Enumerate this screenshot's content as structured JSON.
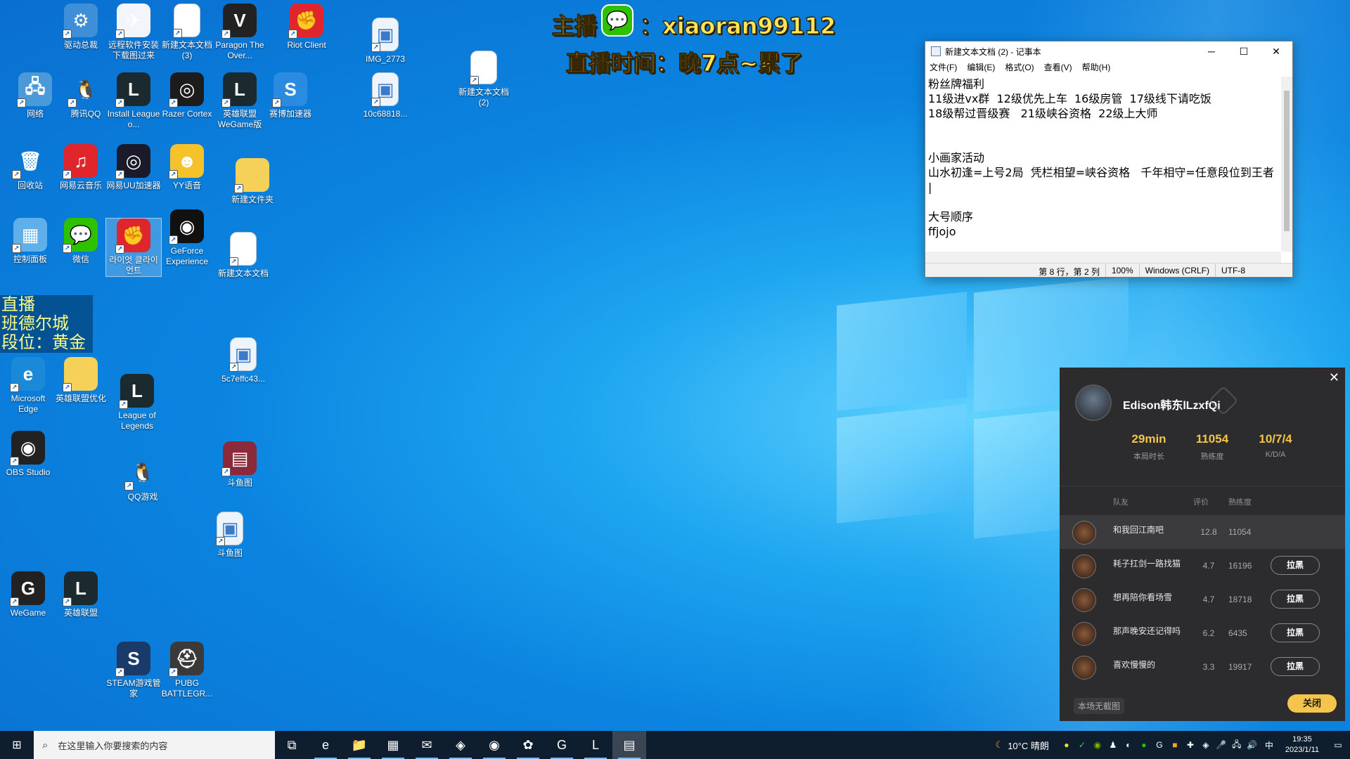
{
  "desktop": {
    "icons": [
      {
        "label": "驱动总裁",
        "glyph": "⚙",
        "bg": "#3f8fd8"
      },
      {
        "label": "远程软件安装下载图过来",
        "glyph": "✈",
        "bg": "#f2f6fa"
      },
      {
        "label": "新建文本文档 (3)",
        "glyph": "",
        "bg": "#ffffff"
      },
      {
        "label": "Paragon The Over...",
        "glyph": "V",
        "bg": "#222"
      },
      {
        "label": "Riot Client",
        "glyph": "✊",
        "bg": "#e0262c"
      },
      {
        "label": "IMG_2773",
        "glyph": "▣",
        "bg": "#eef4fb"
      },
      {
        "label": "新建文本文档 (2)",
        "glyph": "",
        "bg": "#ffffff"
      },
      {
        "label": "网络",
        "glyph": "🖧",
        "bg": "#4a9ad9"
      },
      {
        "label": "腾讯QQ",
        "glyph": "🐧",
        "bg": "transparent"
      },
      {
        "label": "Install League o...",
        "glyph": "L",
        "bg": "#1b2a2e"
      },
      {
        "label": "Razer Cortex",
        "glyph": "◎",
        "bg": "#1c1c1c"
      },
      {
        "label": "英雄联盟WeGame版",
        "glyph": "L",
        "bg": "#1b2a2e"
      },
      {
        "label": "赛博加速器",
        "glyph": "S",
        "bg": "#2a8be0"
      },
      {
        "label": "10c68818...",
        "glyph": "▣",
        "bg": "#eef4fb"
      },
      {
        "label": "回收站",
        "glyph": "🗑",
        "bg": "transparent"
      },
      {
        "label": "网易云音乐",
        "glyph": "♫",
        "bg": "#e0262c"
      },
      {
        "label": "网易UU加速器",
        "glyph": "◎",
        "bg": "#1a1a2a"
      },
      {
        "label": "YY语音",
        "glyph": "☻",
        "bg": "#f6c22a"
      },
      {
        "label": "新建文件夹",
        "glyph": "",
        "bg": "#f6d15a"
      },
      {
        "label": "控制面板",
        "glyph": "▦",
        "bg": "#5fb0ea"
      },
      {
        "label": "微信",
        "glyph": "💬",
        "bg": "#2dc100"
      },
      {
        "label": "라이엇 클라이언트",
        "glyph": "✊",
        "bg": "#e0262c"
      },
      {
        "label": "GeForce Experience",
        "glyph": "◉",
        "bg": "#111"
      },
      {
        "label": "新建文本文档",
        "glyph": "",
        "bg": "#ffffff"
      },
      {
        "label": "Microsoft Edge",
        "glyph": "e",
        "bg": "#1a8ad8"
      },
      {
        "label": "英雄联盟优化",
        "glyph": "",
        "bg": "#f6d15a"
      },
      {
        "label": "League of Legends",
        "glyph": "L",
        "bg": "#1b2a2e"
      },
      {
        "label": "5c7effc43...",
        "glyph": "▣",
        "bg": "#eef4fb"
      },
      {
        "label": "OBS Studio",
        "glyph": "◉",
        "bg": "#222"
      },
      {
        "label": "QQ游戏",
        "glyph": "🐧",
        "bg": "transparent"
      },
      {
        "label": "斗鱼图",
        "glyph": "▤",
        "bg": "#8a2a3a"
      },
      {
        "label": "斗鱼图",
        "glyph": "▣",
        "bg": "#eef4fb"
      },
      {
        "label": "WeGame",
        "glyph": "G",
        "bg": "#222"
      },
      {
        "label": "英雄联盟",
        "glyph": "L",
        "bg": "#1b2a2e"
      },
      {
        "label": "STEAM游戏管家",
        "glyph": "S",
        "bg": "#1a3a6a"
      },
      {
        "label": "PUBG BATTLEGR...",
        "glyph": "⛑",
        "bg": "#3a3a3a"
      }
    ]
  },
  "overlay": {
    "line1_prefix": "主播",
    "line1_suffix": "：xiaoran99112",
    "line2": "直播时间：晚7点~累了",
    "live_box": [
      "直播",
      "班德尔城",
      "段位：黄金"
    ]
  },
  "notepad": {
    "title": "新建文本文档 (2) - 记事本",
    "window_buttons": [
      "─",
      "☐",
      "✕"
    ],
    "menu": [
      "文件(F)",
      "编辑(E)",
      "格式(O)",
      "查看(V)",
      "帮助(H)"
    ],
    "lines": [
      "粉丝牌福利",
      "11级进vx群  12级优先上车  16级房管  17级线下请吃饭",
      "18级帮过晋级赛   21级峡谷资格  22级上大师",
      "",
      "",
      "小画家活动",
      "山水初逢=上号2局  凭栏相望=峡谷资格   千年相守=任意段位到王者",
      "|",
      "",
      "大号顺序",
      "ffjojo"
    ],
    "status": {
      "position": "第 8 行，第 2 列",
      "zoom": "100%",
      "line_ending": "Windows (CRLF)",
      "encoding": "UTF-8"
    }
  },
  "game_panel": {
    "close_glyph": "✕",
    "player_name": "Edison韩东lLzxfQi",
    "stats": [
      {
        "value": "29min",
        "key": "本局时长"
      },
      {
        "value": "11054",
        "key": "熟练度"
      },
      {
        "value": "10/7/4",
        "key": "K/D/A"
      }
    ],
    "headers": {
      "teammate": "队友",
      "rating": "评价",
      "proficiency": "熟练度"
    },
    "rows": [
      {
        "name": "和我回江南吧",
        "rating": "12.8",
        "proficiency": "11054",
        "button": ""
      },
      {
        "name": "耗子扛剑一路找猫",
        "rating": "4.7",
        "proficiency": "16196",
        "button": "拉黑"
      },
      {
        "name": "想再陪你看场雪",
        "rating": "4.7",
        "proficiency": "18718",
        "button": "拉黑"
      },
      {
        "name": "那声晚安还记得吗",
        "rating": "6.2",
        "proficiency": "6435",
        "button": "拉黑"
      },
      {
        "name": "喜欢慢慢的",
        "rating": "3.3",
        "proficiency": "19917",
        "button": "拉黑"
      }
    ],
    "footer_note": "本场无截图",
    "close_button": "关闭"
  },
  "taskbar": {
    "start_glyph": "⊞",
    "search_placeholder": "在这里输入你要搜索的内容",
    "apps": [
      "⧉",
      "e",
      "📁",
      "▦",
      "✉",
      "◈",
      "◉",
      "✿",
      "G",
      "L",
      "▤"
    ],
    "weather": "10°C  晴朗",
    "ime": "中",
    "time": "19:35",
    "date": "2023/1/11"
  }
}
